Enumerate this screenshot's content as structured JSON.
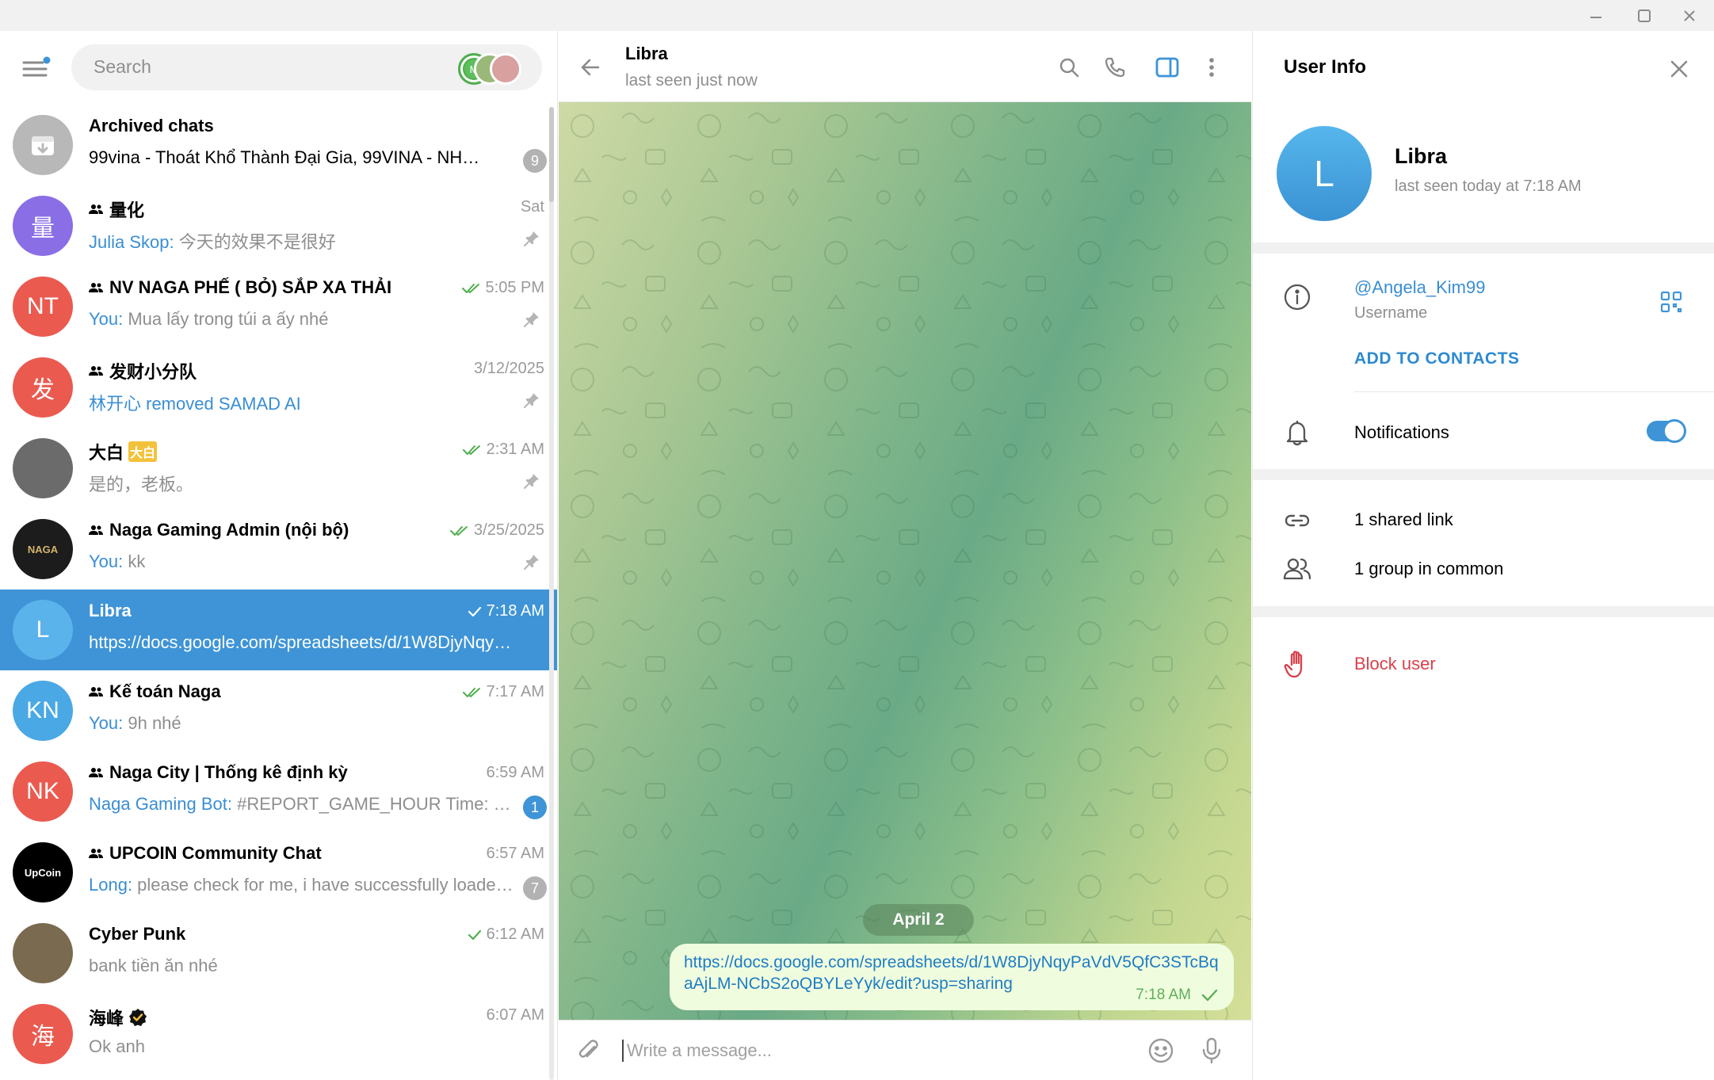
{
  "search": {
    "placeholder": "Search"
  },
  "chats": [
    {
      "name": "Archived chats",
      "preview": "99vina - Thoát Khổ Thành Đại Gia, 99VINA - NHÓM C...",
      "sender": "",
      "time": "",
      "badge": "9",
      "badge_color": "#b2b2b2",
      "avatar_text": "",
      "avatar_color": "#b8b8b8",
      "group": false,
      "check": "none",
      "pinned": false
    },
    {
      "name": "量化",
      "preview": "今天的效果不是很好",
      "sender": "Julia Skop: ",
      "time": "Sat",
      "badge": "",
      "avatar_text": "量",
      "avatar_color": "#8a6ee6",
      "group": true,
      "check": "none",
      "pinned": true
    },
    {
      "name": "NV NAGA PHẾ ( BỎ) SẮP XA THẢI",
      "preview": "Mua lấy trong túi a ấy nhé",
      "sender": "You: ",
      "time": "5:05 PM",
      "badge": "",
      "avatar_text": "NT",
      "avatar_color": "#ea5a4f",
      "group": true,
      "check": "double",
      "pinned": true
    },
    {
      "name": "发财小分队",
      "preview": "林开心 removed SAMAD AI",
      "sender": "",
      "time": "3/12/2025",
      "badge": "",
      "avatar_text": "发",
      "avatar_color": "#ea5a4f",
      "group": true,
      "check": "none",
      "pinned": true,
      "preview_blue": true
    },
    {
      "name": "大白",
      "name_suffix": "大白",
      "preview": "是的，老板。",
      "sender": "",
      "time": "2:31 AM",
      "badge": "",
      "avatar_text": "",
      "avatar_color": "#6b6b6b",
      "group": false,
      "check": "double",
      "pinned": true
    },
    {
      "name": "Naga Gaming Admin (nội bộ)",
      "preview": "kk",
      "sender": "You: ",
      "time": "3/25/2025",
      "badge": "",
      "avatar_text": "NAGA",
      "avatar_color": "#1c1c1c",
      "group": true,
      "check": "double",
      "pinned": true
    },
    {
      "name": "Libra",
      "preview": "https://docs.google.com/spreadsheets/d/1W8DjyNqyPa...",
      "sender": "",
      "time": "7:18 AM",
      "badge": "",
      "avatar_text": "L",
      "avatar_color": "#4aa8e4",
      "group": false,
      "check": "single",
      "pinned": false,
      "active": true
    },
    {
      "name": "Kế toán Naga",
      "preview": "9h nhé",
      "sender": "You: ",
      "time": "7:17 AM",
      "badge": "",
      "avatar_text": "KN",
      "avatar_color": "#4aa8e4",
      "group": true,
      "check": "double",
      "pinned": false
    },
    {
      "name": "Naga City | Thống kê định kỳ",
      "preview": "#REPORT_GAME_HOUR Time: 4/2/...",
      "sender": "Naga Gaming Bot: ",
      "time": "6:59 AM",
      "badge": "1",
      "badge_color": "#3e94d6",
      "avatar_text": "NK",
      "avatar_color": "#ea5a4f",
      "group": true,
      "check": "none",
      "pinned": false
    },
    {
      "name": "UPCOIN Community Chat",
      "preview": "please check for me, i have successfully loaded...",
      "sender": "Long: ",
      "time": "6:57 AM",
      "badge": "7",
      "badge_color": "#b2b2b2",
      "avatar_text": "UpCoin",
      "avatar_color": "#000000",
      "group": true,
      "check": "none",
      "pinned": false
    },
    {
      "name": "Cyber Punk",
      "preview": "bank tiền ăn nhé",
      "sender": "",
      "time": "6:12 AM",
      "badge": "",
      "avatar_text": "",
      "avatar_color": "#7a6a4f",
      "group": false,
      "check": "single",
      "pinned": false
    },
    {
      "name": "海峰",
      "preview": "Ok anh",
      "sender": "",
      "time": "6:07 AM",
      "badge": "",
      "avatar_text": "海",
      "avatar_color": "#ea5a4f",
      "group": false,
      "check": "none",
      "pinned": false,
      "verified": true
    }
  ],
  "conversation": {
    "title": "Libra",
    "status": "last seen just now",
    "date_label": "April 2",
    "message_text": "https://docs.google.com/spreadsheets/d/1W8DjyNqyPaVdV5QfC3STcBqaAjLM-NCbS2oQBYLeYyk/edit?usp=sharing",
    "message_time": "7:18 AM",
    "composer_placeholder": "Write a message..."
  },
  "user_info": {
    "panel_title": "User Info",
    "avatar_letter": "L",
    "name": "Libra",
    "last_seen": "last seen today at 7:18 AM",
    "username": "@Angela_Kim99",
    "username_label": "Username",
    "add_to_contacts": "ADD TO CONTACTS",
    "notifications_label": "Notifications",
    "notifications_on": true,
    "shared_links": "1 shared link",
    "groups_in_common": "1 group in common",
    "block_label": "Block user"
  },
  "colors": {
    "accent": "#3e94d6",
    "danger": "#d9414b",
    "read_check": "#4fae4e"
  }
}
